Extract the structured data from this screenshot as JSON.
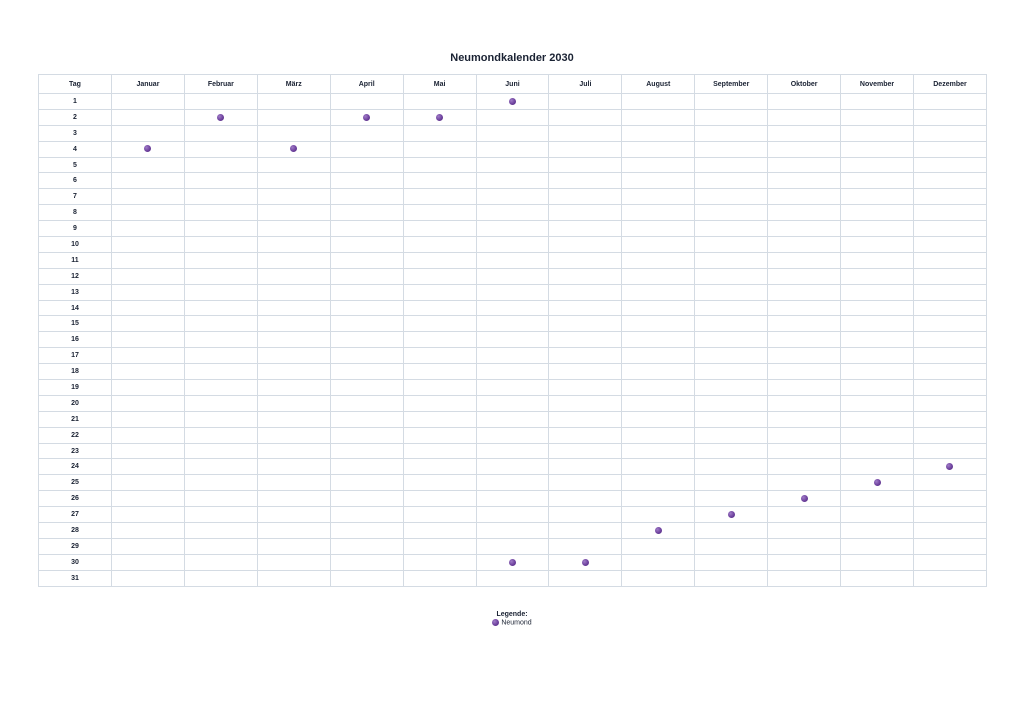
{
  "title": "Neumondkalender 2030",
  "header": {
    "day_label": "Tag",
    "months": [
      "Januar",
      "Februar",
      "März",
      "April",
      "Mai",
      "Juni",
      "Juli",
      "August",
      "September",
      "Oktober",
      "November",
      "Dezember"
    ]
  },
  "days": [
    "1",
    "2",
    "3",
    "4",
    "5",
    "6",
    "7",
    "8",
    "9",
    "10",
    "11",
    "12",
    "13",
    "14",
    "15",
    "16",
    "17",
    "18",
    "19",
    "20",
    "21",
    "22",
    "23",
    "24",
    "25",
    "26",
    "27",
    "28",
    "29",
    "30",
    "31"
  ],
  "new_moons": [
    {
      "month": 1,
      "day": 4
    },
    {
      "month": 2,
      "day": 2
    },
    {
      "month": 3,
      "day": 4
    },
    {
      "month": 4,
      "day": 2
    },
    {
      "month": 5,
      "day": 2
    },
    {
      "month": 6,
      "day": 1
    },
    {
      "month": 6,
      "day": 30
    },
    {
      "month": 7,
      "day": 30
    },
    {
      "month": 8,
      "day": 28
    },
    {
      "month": 9,
      "day": 27
    },
    {
      "month": 10,
      "day": 26
    },
    {
      "month": 11,
      "day": 25
    },
    {
      "month": 12,
      "day": 24
    }
  ],
  "legend": {
    "title": "Legende:",
    "item_label": "Neumond",
    "marker_color": "#6a3d9a",
    "marker_icon": "new-moon-dot-icon"
  }
}
